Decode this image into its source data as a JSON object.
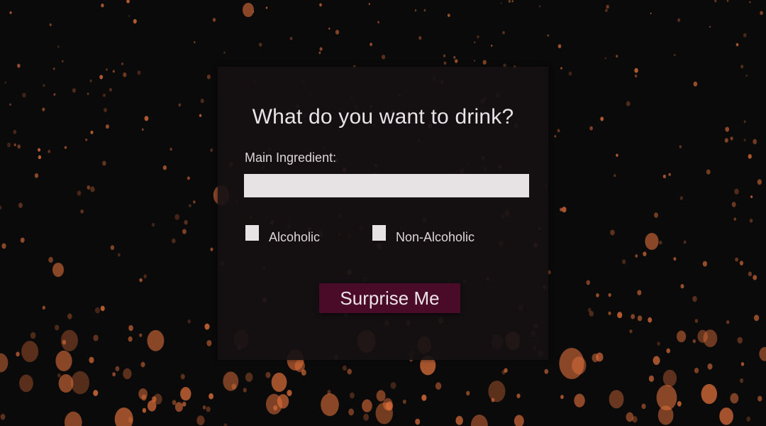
{
  "form": {
    "title": "What do you want to drink?",
    "ingredient_label": "Main Ingredient:",
    "ingredient_value": "",
    "ingredient_placeholder": "",
    "alcoholic_label": "Alcoholic",
    "alcoholic_checked": false,
    "non_alcoholic_label": "Non-Alcoholic",
    "non_alcoholic_checked": false,
    "submit_label": "Surprise Me"
  },
  "colors": {
    "background": "#0a0a0b",
    "card": "#161113",
    "button": "#4a0b29",
    "lantern": "#e0703a"
  },
  "background_image": "floating-sky-lanterns-at-night"
}
